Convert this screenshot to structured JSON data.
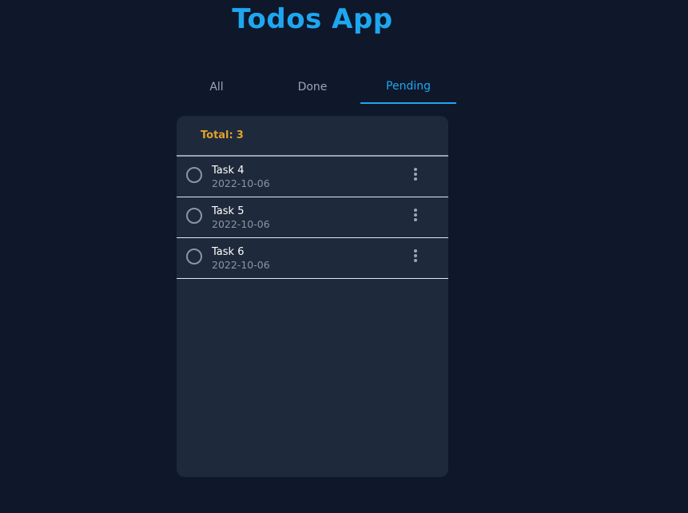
{
  "app": {
    "title": "Todos App"
  },
  "tabs": [
    {
      "label": "All",
      "active": false
    },
    {
      "label": "Done",
      "active": false
    },
    {
      "label": "Pending",
      "active": true
    }
  ],
  "summary": {
    "total_label": "Total:",
    "total_count": "3"
  },
  "tasks": [
    {
      "name": "Task 4",
      "date": "2022-10-06",
      "done": false
    },
    {
      "name": "Task 5",
      "date": "2022-10-06",
      "done": false
    },
    {
      "name": "Task 6",
      "date": "2022-10-06",
      "done": false
    }
  ],
  "colors": {
    "background": "#0f172a",
    "panel": "#1e293b",
    "accent": "#1ea7f0",
    "total": "#e0a22a",
    "muted": "#8b95a5"
  },
  "icons": {
    "checkbox": "circle-outline-icon",
    "menu": "more-vertical-icon"
  }
}
